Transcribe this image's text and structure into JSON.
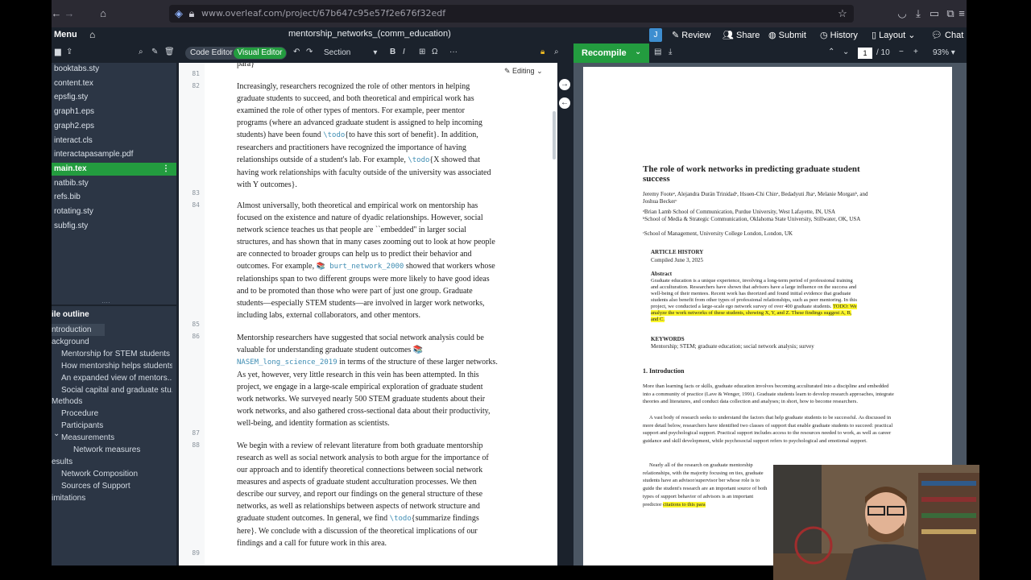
{
  "browser": {
    "url": "www.overleaf.com/project/67b647c95e57f2e676f32edf",
    "back_icon": "back-arrow-icon",
    "forward_icon": "forward-arrow-icon",
    "home_icon": "home-icon"
  },
  "app": {
    "menu_label": "Menu",
    "project_title": "mentorship_networks_(comm_education)",
    "avatar_letter": "J",
    "review_label": "Review",
    "share_label": "Share",
    "submit_label": "Submit",
    "history_label": "History",
    "layout_label": "Layout",
    "chat_label": "Chat"
  },
  "toolbar": {
    "code_editor_label": "Code Editor",
    "visual_editor_label": "Visual Editor",
    "section_label": "Section",
    "bold": "B",
    "italic": "I",
    "omega": "Ω",
    "more": "···",
    "recompile_label": "Recompile",
    "page_current": "1",
    "page_total": "/ 10",
    "zoom": "93%"
  },
  "files": [
    {
      "name": "booktabs.sty",
      "active": false
    },
    {
      "name": "content.tex",
      "active": false
    },
    {
      "name": "epsfig.sty",
      "active": false
    },
    {
      "name": "graph1.eps",
      "active": false
    },
    {
      "name": "graph2.eps",
      "active": false
    },
    {
      "name": "interact.cls",
      "active": false
    },
    {
      "name": "interactapasample.pdf",
      "active": false
    },
    {
      "name": "main.tex",
      "active": true
    },
    {
      "name": "natbib.sty",
      "active": false
    },
    {
      "name": "refs.bib",
      "active": false
    },
    {
      "name": "rotating.sty",
      "active": false
    },
    {
      "name": "subfig.sty",
      "active": false
    }
  ],
  "outline": {
    "title": "ile outline",
    "items": [
      {
        "label": "ntroduction",
        "level": 0
      },
      {
        "label": "ackground",
        "level": 0
      },
      {
        "label": "Mentorship for STEM students",
        "level": 1
      },
      {
        "label": "How mentorship helps students",
        "level": 1
      },
      {
        "label": "An expanded view of mentors...",
        "level": 1
      },
      {
        "label": "Social capital and graduate stu...",
        "level": 1
      },
      {
        "label": "Methods",
        "level": 0
      },
      {
        "label": "Procedure",
        "level": 1
      },
      {
        "label": "Participants",
        "level": 1
      },
      {
        "label": "Measurements",
        "level": 1
      },
      {
        "label": "Network measures",
        "level": 2
      },
      {
        "label": "esults",
        "level": 0
      },
      {
        "label": "Network Composition",
        "level": 1
      },
      {
        "label": "Sources of Support",
        "level": 1
      },
      {
        "label": "imitations",
        "level": 0
      }
    ]
  },
  "editor": {
    "mode_label": "Editing",
    "top_fragment": "para}",
    "line_numbers": [
      "81",
      "82",
      "83",
      "84",
      "85",
      "86",
      "87",
      "88",
      "89"
    ],
    "para1": [
      "Increasingly, researchers recognized the role of other mentors in helping",
      "graduate students to succeed, and both theoretical and empirical work has",
      "examined the role of other types of mentors. For example, peer mentor",
      "programs (where an advanced graduate student is assigned to help incoming",
      "researchers and practitioners have recognized the importance of having",
      "relationships outside of a student's lab. For example, ",
      "having work relationships with faculty outside of the university was associated",
      "with Y outcomes}."
    ],
    "para1_line5_pre": "students) have been found ",
    "para1_line5_cmd": "\\todo",
    "para1_line5_post": "{to have this sort of benefit}. In addition,",
    "para1_line7_cmd": "\\todo",
    "para1_line7_post": "{X showed that",
    "para2": [
      "Almost universally, both theoretical and empirical work on mentorship has",
      "focused on the existence and nature of dyadic relationships. However, social",
      "network science teaches us that people are ``embedded'' in larger social",
      "structures, and has shown that in many cases zooming out to look at how people",
      "are connected to broader groups can help us to predict their behavior and",
      "relationships span to two different groups were more likely to have good ideas",
      "and to be promoted than those who were part of just one group. Graduate",
      "students—especially STEM students—are involved in larger work networks,",
      "including labs, external collaborators, and other mentors."
    ],
    "para2_line6_pre": "outcomes. For example, ",
    "para2_line6_cite": "📚 burt_network_2000",
    "para2_line6_post": " showed that workers whose",
    "para3": [
      "Mentorship researchers have suggested that social network analysis could be",
      "valuable for understanding graduate student outcomes 📚",
      "As yet, however, very little research in this vein has been attempted. In this",
      "project, we engage in a large-scale empirical exploration of graduate student",
      "work networks. We surveyed nearly 500 STEM graduate students about their",
      "work networks, and also gathered cross-sectional data about their productivity,",
      "well-being, and identity formation as scientists."
    ],
    "para3_line3_cite": "NASEM_long_science_2019",
    "para3_line3_post": " in terms of the structure of these larger networks.",
    "para4": [
      "We begin with a review of relevant literature from both graduate mentorship",
      "research as well as social network analysis to both argue for the importance of",
      "our approach and to identify theoretical connections between social network",
      "measures and aspects of graduate student acculturation processes. We then",
      "describe our survey, and report our findings on the general structure of these",
      "networks, as well as relationships between aspects of network structure and",
      "here}. We conclude with a discussion of the theoretical implications of our",
      "findings and a call for future work in this area."
    ],
    "para4_line7_pre": "graduate student outcomes. In general, we find ",
    "para4_line7_cmd": "\\todo",
    "para4_line7_post": "{summarize findings"
  },
  "pdf": {
    "title": "The role of work networks in predicting graduate student success",
    "authors": "Jeremy Footeᵃ, Alejandra Durán Trinidadᵃ, Hsuen-Chi Chinᵃ, Bedadyuti Jhaᵃ, Melanie Morganᵇ, and Joshua Beckerᶜ",
    "aff1": "ᵃBrian Lamb School of Communication, Purdue University, West Lafayette, IN, USA",
    "aff2": "ᵇSchool of Media & Strategic Communication, Oklahoma State University, Stillwater, OK, USA",
    "aff3": "ᶜSchool of Management, University College London, London, UK",
    "history_head": "ARTICLE HISTORY",
    "compiled": "Compiled June 3, 2025",
    "abstract_head": "Abstract",
    "abstract": "Graduate education is a unique experience, involving a long-term period of professional training and acculturation. Researchers have shown that advisors have a large influence on the success and well-being of their mentees. Recent work has theorized and found initial evidence that graduate students also benefit from other types of professional relationships, such as peer mentoring. In this project, we conducted a large-scale ego network survey of over 400 graduate students.",
    "abstract_todo": "TODO: We analyze the work networks of these students, showing X, Y, and Z. These findings suggest A, B, and C.",
    "keywords_head": "KEYWORDS",
    "keywords": "Mentorship; STEM; graduate education; social network analysis; survey",
    "intro_head": "1.  Introduction",
    "intro1": "More than learning facts or skills, graduate education involves becoming acculturated into a discipline and embedded into a community of practice (Lave & Wenger, 1991). Graduate students learn to develop research approaches, integrate theories and literatures, and conduct data collection and analyses; in short, how to become researchers.",
    "intro2": "A vast body of research seeks to understand the factors that help graduate students to be successful. As discussed in more detail below, researchers have identified two classes of support that enable graduate students to succeed: practical support and psychological support. Practical support includes access to the resources needed to work, as well as career guidance and skill development, while psychosocial support refers to psychological and emotional support.",
    "intro3": "Nearly all of the research on graduate mentorship relationships, with the majority focusing on ties, graduate students have an advisor/supervisor ber whose role is to guide the student's research are an important source of both types of support behavior of advisors is an important predictor",
    "intro_todo": "citations to this para"
  }
}
